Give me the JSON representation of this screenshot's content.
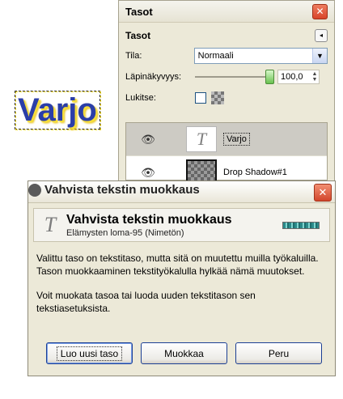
{
  "canvas": {
    "text": "Varjo"
  },
  "layers_window": {
    "title": "Tasot",
    "panel_title": "Tasot",
    "mode_label": "Tila:",
    "mode_value": "Normaali",
    "opacity_label": "Läpinäkyvyys:",
    "opacity_value": "100,0",
    "lock_label": "Lukitse:",
    "layers": [
      {
        "name": "Varjo",
        "thumb": "text",
        "selected": true
      },
      {
        "name": "Drop Shadow#1",
        "thumb": "checker",
        "selected": false
      }
    ]
  },
  "dialog": {
    "title": "Vahvista tekstin muokkaus",
    "header_title": "Vahvista tekstin muokkaus",
    "header_subtitle": "Elämysten loma-95 (Nimetön)",
    "paragraph1": "Valittu taso on tekstitaso, mutta sitä on muutettu muilla työkaluilla. Tason muokkaaminen tekstityökalulla hylkää nämä muutokset.",
    "paragraph2": "Voit muokata tasoa tai luoda uuden tekstitason sen tekstiasetuksista.",
    "buttons": {
      "new_layer": "Luo uusi taso",
      "edit": "Muokkaa",
      "cancel": "Peru"
    }
  },
  "colors": {
    "canvas_text": "#2b3ea8",
    "canvas_shadow": "#f6de3a",
    "dialog_bg": "#ece9d8",
    "selected_row": "#cdcbc4",
    "close_button": "#d8442a"
  },
  "icons": {
    "visibility": "eye-icon",
    "text_tool": "text-t-icon",
    "close": "close-icon"
  }
}
